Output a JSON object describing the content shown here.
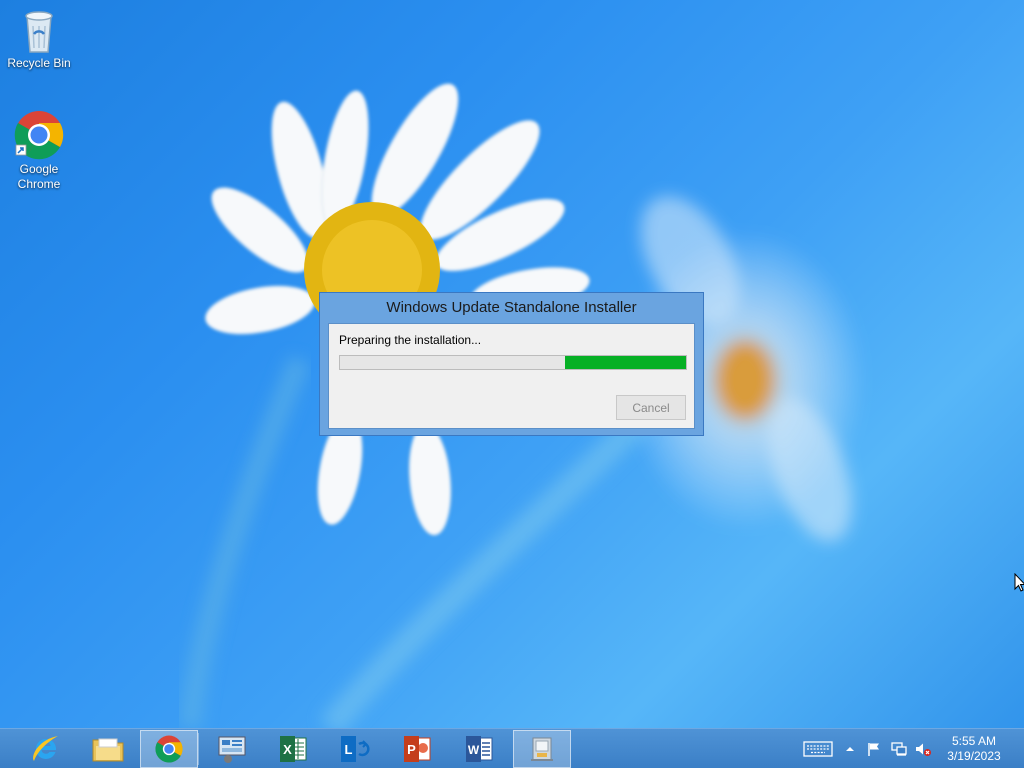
{
  "desktop": {
    "icons": [
      {
        "label": "Recycle Bin",
        "icon": "recycle-bin-icon"
      },
      {
        "label": "Google Chrome",
        "icon": "chrome-icon"
      }
    ]
  },
  "dialog": {
    "title": "Windows Update Standalone Installer",
    "status": "Preparing the installation...",
    "progress_percent": 35,
    "progress_mode": "marquee",
    "cancel_label": "Cancel",
    "cancel_enabled": false,
    "progress_color": "#06b025"
  },
  "taskbar": {
    "pinned": [
      {
        "name": "internet-explorer",
        "icon": "internet-explorer-icon"
      },
      {
        "name": "file-explorer",
        "icon": "folder-icon"
      },
      {
        "name": "google-chrome",
        "icon": "chrome-icon"
      },
      {
        "name": "server-manager",
        "icon": "server-manager-icon"
      },
      {
        "name": "excel",
        "icon": "excel-icon"
      },
      {
        "name": "lync",
        "icon": "lync-icon"
      },
      {
        "name": "powerpoint",
        "icon": "powerpoint-icon"
      },
      {
        "name": "word",
        "icon": "word-icon"
      },
      {
        "name": "update-installer",
        "icon": "installer-icon"
      }
    ],
    "tray": {
      "icons": [
        "keyboard-icon",
        "show-hidden-icons-icon",
        "action-center-flag-icon",
        "network-icon",
        "volume-muted-icon"
      ],
      "time": "5:55 AM",
      "date": "3/19/2023"
    },
    "background_color": "#3b7fc6"
  }
}
